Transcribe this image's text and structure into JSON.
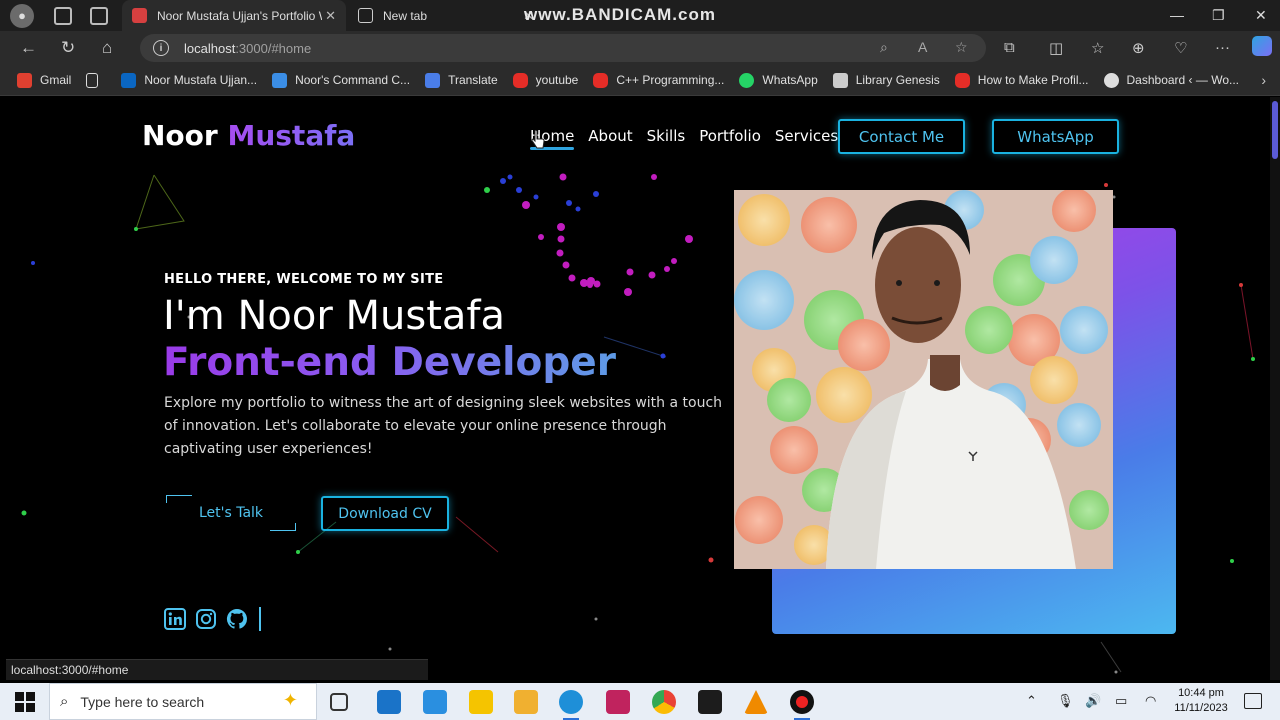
{
  "browser": {
    "watermark": "www.BANDICAM.com",
    "tabs": [
      {
        "title": "Noor Mustafa Ujjan's Portfolio W",
        "active": true,
        "favicon_color": "#d64040"
      },
      {
        "title": "New tab",
        "active": false
      }
    ],
    "address": {
      "host": "localhost",
      "rest": ":3000/#home"
    },
    "bookmarks": [
      {
        "label": "Gmail",
        "icon_color": "#e04030"
      },
      {
        "label": "",
        "icon_color": "#dddddd"
      },
      {
        "label": "Noor Mustafa Ujjan...",
        "icon_color": "#0a66c2"
      },
      {
        "label": "Noor's Command C...",
        "icon_color": "#3b8ee6"
      },
      {
        "label": "Translate",
        "icon_color": "#4a7de8"
      },
      {
        "label": "youtube",
        "icon_color": "#e52d27"
      },
      {
        "label": "C++ Programming...",
        "icon_color": "#e52d27"
      },
      {
        "label": "WhatsApp",
        "icon_color": "#25d366"
      },
      {
        "label": "Library Genesis",
        "icon_color": "#cccccc"
      },
      {
        "label": "How to Make Profil...",
        "icon_color": "#e52d27"
      },
      {
        "label": "Dashboard ‹ — Wo...",
        "icon_color": "#dddddd"
      }
    ],
    "status_url": "localhost:3000/#home"
  },
  "site": {
    "logo_first": "Noor",
    "logo_second": "Mustafa",
    "nav": [
      "Home",
      "About",
      "Skills",
      "Portfolio",
      "Services"
    ],
    "contact_btn": "Contact Me",
    "whatsapp_btn": "WhatsApp",
    "hello": "HELLO THERE, WELCOME TO MY SITE",
    "name_line": "I'm Noor Mustafa",
    "role": "Front-end Developer",
    "description": "Explore my portfolio to witness the art of designing sleek websites with a touch of innovation. Let's collaborate to elevate your online presence through captivating user experiences!",
    "talk_btn": "Let's Talk",
    "cv_btn": "Download CV",
    "socials": [
      "linkedin-icon",
      "instagram-icon",
      "github-icon"
    ]
  },
  "taskbar": {
    "search_placeholder": "Type here to search",
    "time": "10:44 pm",
    "date": "11/11/2023"
  },
  "colors": {
    "accent_cyan": "#1ab2e0",
    "accent_purple": "#a64df0",
    "page_bg": "#000000"
  }
}
